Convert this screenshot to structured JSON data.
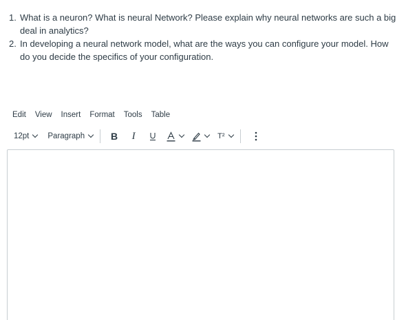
{
  "questions": [
    {
      "number": "1.",
      "text": "What is a neuron? What is neural Network? Please explain why neural networks are such a big deal in analytics?"
    },
    {
      "number": "2.",
      "text": "In developing a neural network model, what are the ways you can configure your model. How do you decide the specifics of your configuration."
    }
  ],
  "menubar": {
    "edit": "Edit",
    "view": "View",
    "insert": "Insert",
    "format": "Format",
    "tools": "Tools",
    "table": "Table"
  },
  "toolbar": {
    "font_size": "12pt",
    "block_format": "Paragraph",
    "bold_label": "B",
    "italic_label": "I",
    "underline_label": "U",
    "text_color_label": "A",
    "superscript_label": "T²",
    "more_label": "···"
  },
  "icons": {
    "text_color": "text-color-icon",
    "highlight": "highlight-icon",
    "superscript": "superscript-icon",
    "more": "more-vertical-icon"
  },
  "colors": {
    "text": "#2d3b45",
    "border": "#c7cdd1"
  }
}
